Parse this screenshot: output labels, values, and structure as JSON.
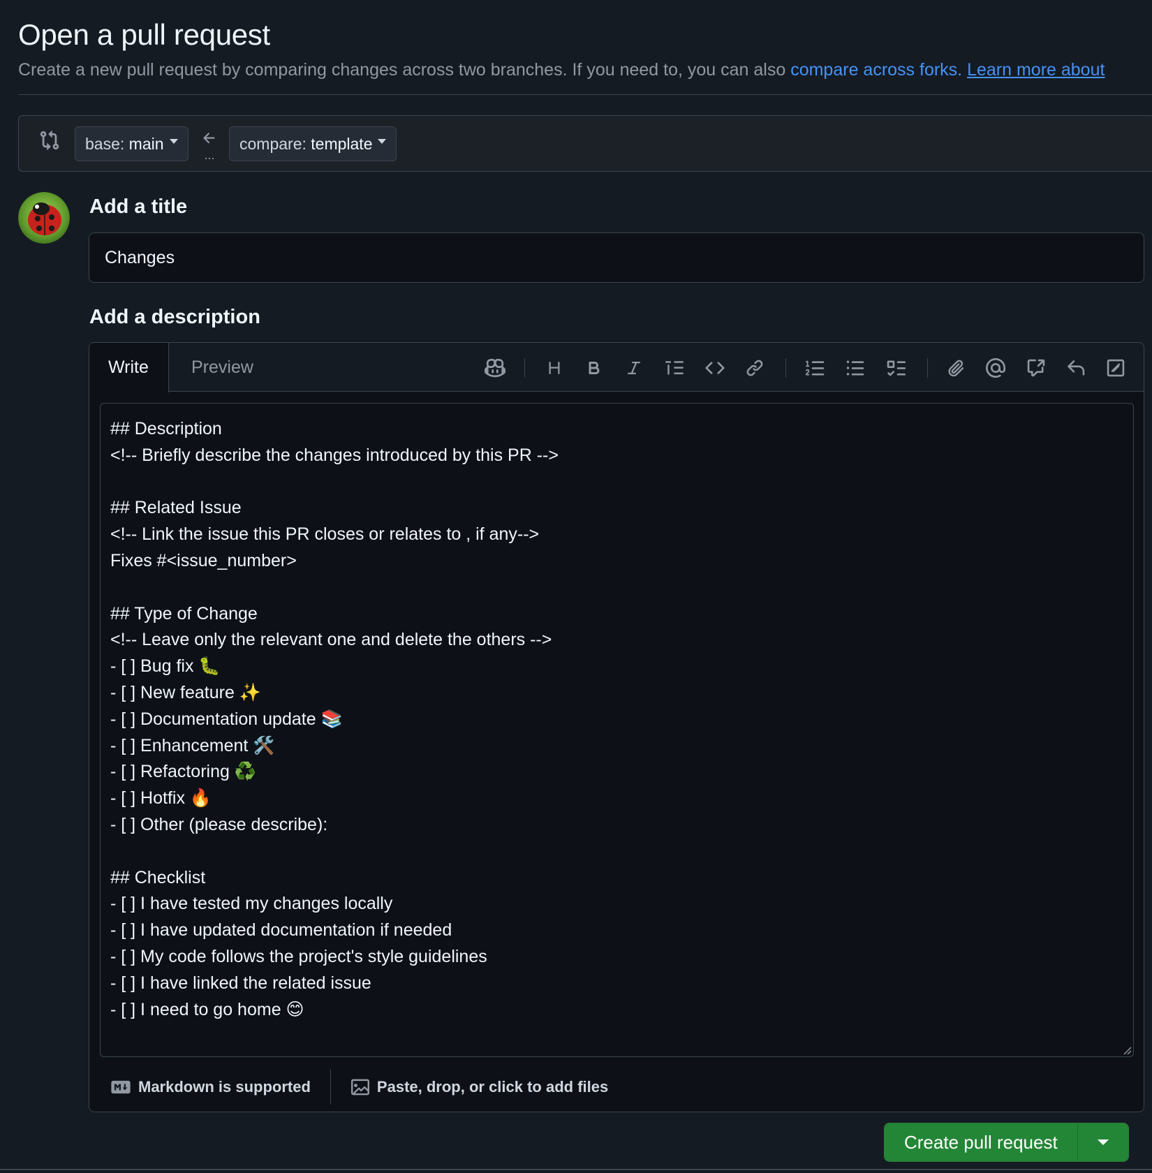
{
  "header": {
    "title": "Open a pull request",
    "subtitle_text": "Create a new pull request by comparing changes across two branches. If you need to, you can also ",
    "compare_forks_link": "compare across forks.",
    "learn_more_link": "Learn more about"
  },
  "range": {
    "base_prefix": "base: ",
    "base_branch": "main",
    "compare_prefix": "compare: ",
    "compare_branch": "template",
    "arrow_ellipsis": "..."
  },
  "title_section": {
    "label": "Add a title",
    "value": "Changes"
  },
  "description_section": {
    "label": "Add a description",
    "tabs": [
      "Write",
      "Preview"
    ],
    "active_tab": "Write",
    "toolbar_icons": [
      "copilot-icon",
      "heading-icon",
      "bold-icon",
      "italic-icon",
      "quote-icon",
      "code-icon",
      "link-icon",
      "ordered-list-icon",
      "unordered-list-icon",
      "task-list-icon",
      "attach-icon",
      "mention-icon",
      "cross-reference-icon",
      "saved-replies-icon",
      "slash-commands-icon"
    ],
    "lines": [
      "## Description",
      "<!-- Briefly describe the changes introduced by this PR -->",
      "",
      "## Related Issue",
      "<!-- Link the issue this PR closes or relates to , if any-->",
      "Fixes #<issue_number>",
      "",
      "## Type of Change",
      "<!-- Leave only the relevant one and delete the others -->",
      "- [ ] Bug fix 🐛",
      "- [ ] New feature ✨",
      "- [ ] Documentation update 📚",
      "- [ ] Enhancement 🛠️",
      "- [ ] Refactoring ♻️",
      "- [ ] Hotfix 🔥",
      "- [ ] Other (please describe):",
      "",
      "## Checklist",
      "- [ ] I have tested my changes locally",
      "- [ ] I have updated documentation if needed",
      "- [ ] My code follows the project's style guidelines",
      "- [ ] I have linked the related issue",
      "- [ ] I need to go home 😊"
    ],
    "footer_markdown": "Markdown is supported",
    "footer_files": "Paste, drop, or click to add files"
  },
  "actions": {
    "create_label": "Create pull request"
  },
  "colors": {
    "background": "#151b23",
    "link": "#4493f8",
    "primary_button": "#238636"
  }
}
